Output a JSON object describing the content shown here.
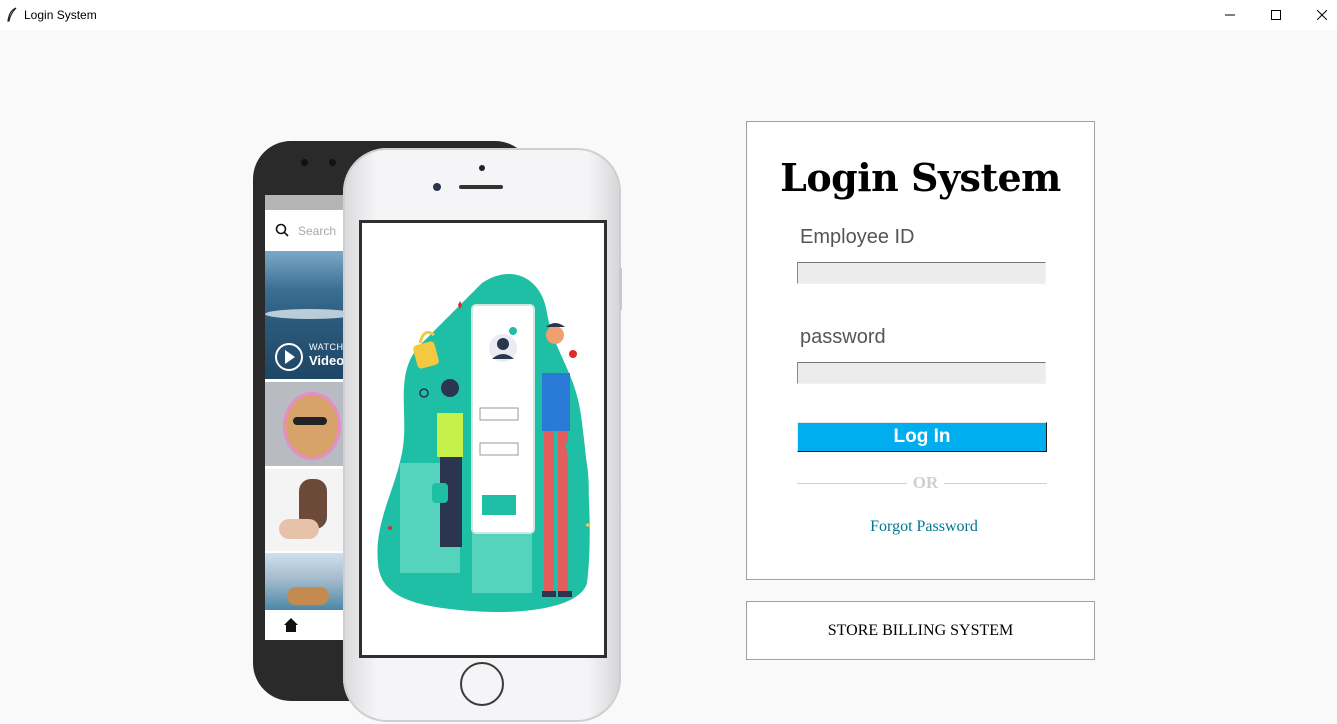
{
  "window": {
    "title": "Login System",
    "controls": [
      "minimize",
      "maximize",
      "close"
    ]
  },
  "phone_back": {
    "search_placeholder": "Search",
    "watch_label": "WATCH",
    "video_label": "Video"
  },
  "login": {
    "heading": "Login System",
    "employee_label": "Employee ID",
    "employee_value": "",
    "password_label": "password",
    "password_value": "",
    "login_button": "Log In",
    "or_text": "OR",
    "forgot_link": "Forgot Password"
  },
  "store": {
    "label": "STORE BILLING SYSTEM"
  },
  "colors": {
    "background": "#f9f9f9",
    "login_button": "#00adef",
    "forgot_link": "#00758f",
    "illustration_teal": "#1fbfa5"
  }
}
